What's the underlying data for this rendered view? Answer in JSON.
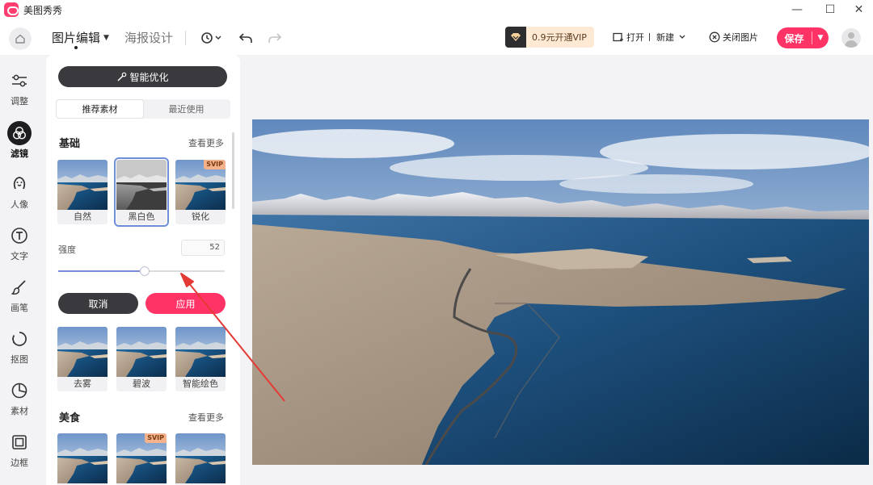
{
  "app": {
    "title": "美图秀秀"
  },
  "window": {
    "minimize": "—",
    "maximize": "☐",
    "close": "✕"
  },
  "toolbar": {
    "tab_main": "图片编辑",
    "tab_second": "海报设计",
    "vip_label": "0.9元开通VIP",
    "open_label": "打开",
    "new_label": "新建",
    "close_image_label": "关闭图片",
    "save_label": "保存"
  },
  "sidebar": {
    "items": [
      {
        "label": "调整",
        "icon": "sliders-icon"
      },
      {
        "label": "滤镜",
        "icon": "filter-circles-icon"
      },
      {
        "label": "人像",
        "icon": "portrait-icon"
      },
      {
        "label": "文字",
        "icon": "text-icon"
      },
      {
        "label": "画笔",
        "icon": "brush-icon"
      },
      {
        "label": "抠图",
        "icon": "cutout-icon"
      },
      {
        "label": "素材",
        "icon": "sticker-icon"
      },
      {
        "label": "边框",
        "icon": "frame-icon"
      }
    ],
    "active": "滤镜"
  },
  "panel": {
    "smart_optimize": "智能优化",
    "tabs": [
      "推荐素材",
      "最近使用"
    ],
    "active_tab": "推荐素材",
    "section_basic": {
      "title": "基础",
      "more": "查看更多"
    },
    "basic_filters": [
      {
        "name": "自然",
        "svip": ""
      },
      {
        "name": "黑白色",
        "svip": "",
        "selected": true
      },
      {
        "name": "锐化",
        "svip": "SVIP"
      }
    ],
    "strength_label": "强度",
    "strength_value": "52",
    "strength_fraction": 0.52,
    "cancel_label": "取消",
    "apply_label": "应用",
    "more_filters": [
      {
        "name": "去雾"
      },
      {
        "name": "碧波"
      },
      {
        "name": "智能绘色"
      }
    ],
    "section_food": {
      "title": "美食",
      "more": "查看更多"
    },
    "food_filters": [
      {
        "name": "",
        "svip": ""
      },
      {
        "name": "",
        "svip": "SVIP"
      },
      {
        "name": "",
        "svip": ""
      }
    ]
  },
  "colors": {
    "accent": "#ff3366",
    "dark_button": "#3a3a3e",
    "slider": "#7a8bd6",
    "arrow": "#e53935"
  }
}
